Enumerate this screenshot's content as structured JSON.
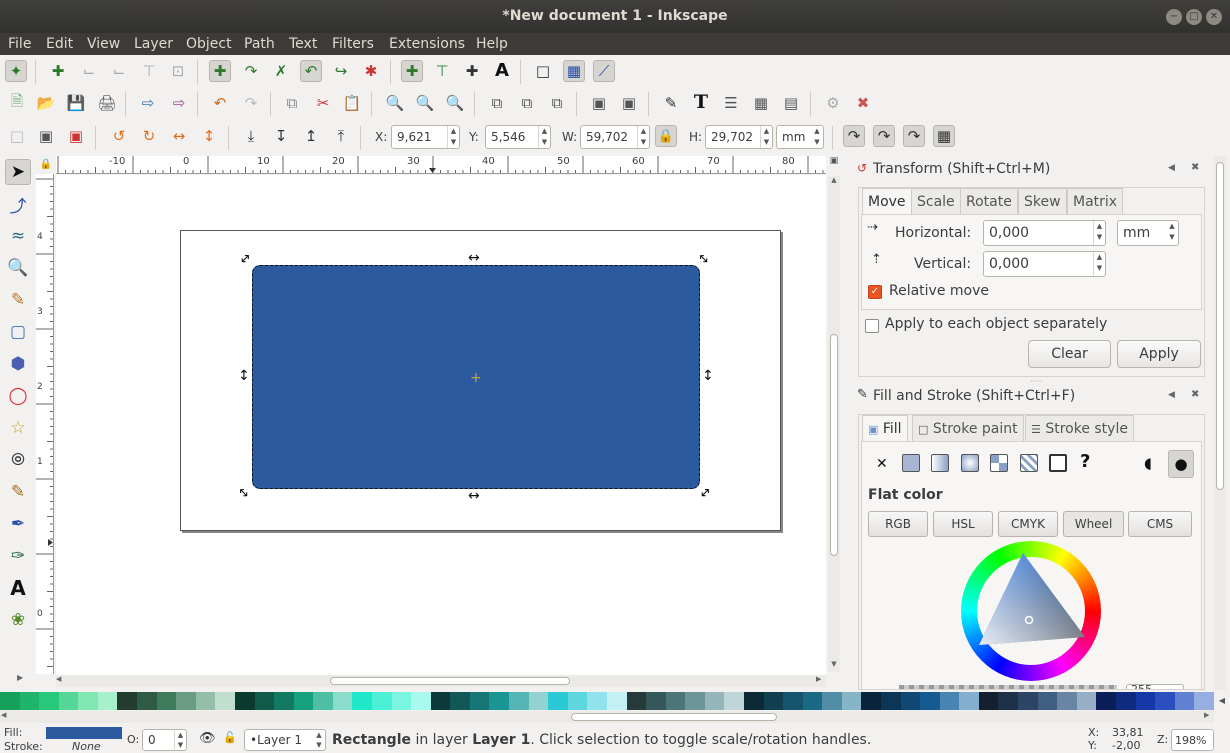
{
  "window": {
    "title": "*New document 1 - Inkscape",
    "buttons": [
      "−",
      "□",
      "✕"
    ]
  },
  "menubar": [
    "File",
    "Edit",
    "View",
    "Layer",
    "Object",
    "Path",
    "Text",
    "Filters",
    "Extensions",
    "Help"
  ],
  "toolbar": {
    "x_label": "X:",
    "x_value": "9,621",
    "y_label": "Y:",
    "y_value": "5,546",
    "w_label": "W:",
    "w_value": "59,702",
    "h_label": "H:",
    "h_value": "29,702",
    "unit": "mm"
  },
  "rulers": {
    "h_labels": [
      "-10",
      "0",
      "10",
      "20",
      "30",
      "40",
      "50",
      "60",
      "70",
      "80"
    ],
    "v_labels": [
      "4",
      "3",
      "2",
      "1",
      "0"
    ]
  },
  "transform_panel": {
    "title": "Transform (Shift+Ctrl+M)",
    "tabs": [
      "Move",
      "Scale",
      "Rotate",
      "Skew",
      "Matrix"
    ],
    "horizontal_label": "Horizontal:",
    "horizontal_value": "0,000",
    "vertical_label": "Vertical:",
    "vertical_value": "0,000",
    "unit": "mm",
    "relative_move": "Relative move",
    "apply_each": "Apply to each object separately",
    "clear": "Clear",
    "apply": "Apply"
  },
  "fill_panel": {
    "title": "Fill and Stroke (Shift+Ctrl+F)",
    "tabs": [
      "Fill",
      "Stroke paint",
      "Stroke style"
    ],
    "flat_color": "Flat color",
    "modes": [
      "RGB",
      "HSL",
      "CMYK",
      "Wheel",
      "CMS"
    ],
    "alpha_partial": "255"
  },
  "statusbar": {
    "fill_label": "Fill:",
    "stroke_label": "Stroke:",
    "stroke_value": "None",
    "opacity_label": "O:",
    "opacity_value": "0",
    "layer": "•Layer 1",
    "msg_bold1": "Rectangle",
    "msg1": " in layer ",
    "msg_bold2": "Layer 1",
    "msg2": ". Click selection to toggle scale/rotation handles.",
    "x_label": "X:",
    "x_value": "33,81",
    "y_label": "Y:",
    "y_value": "-2,00",
    "zoom_label": "Z:",
    "zoom_value": "198%"
  },
  "colors": {
    "rect_fill": "#2b5a9e",
    "accent": "#e95420"
  },
  "palette": [
    "#17a05a",
    "#1fb46a",
    "#27c87a",
    "#54d796",
    "#80e6b2",
    "#a8f0cc",
    "#243b30",
    "#2f5a45",
    "#3e7a5c",
    "#6a9c83",
    "#95bea9",
    "#c1dfd0",
    "#0b3a2f",
    "#0f5a48",
    "#137a62",
    "#17a07f",
    "#4fbfa4",
    "#8addca",
    "#1ee8c8",
    "#4cf0d6",
    "#7af5e2",
    "#a8faee",
    "#0c3a3a",
    "#115757",
    "#167575",
    "#1b9494",
    "#56b6b6",
    "#93d2d2",
    "#2ac9d6",
    "#5dd6e0",
    "#90e3ea",
    "#c3f0f4",
    "#263a3c",
    "#35575a",
    "#4b7579",
    "#6d9599",
    "#95b6b9",
    "#bfd6d8",
    "#0c2a35",
    "#103f50",
    "#15546b",
    "#1a6a86",
    "#4f8ea6",
    "#86b5c7",
    "#08233a",
    "#0c3557",
    "#104774",
    "#155a91",
    "#4a84b2",
    "#82aed0",
    "#142030",
    "#1f3148",
    "#2d4564",
    "#405d82",
    "#6a84a4",
    "#98adc6",
    "#0a1e5a",
    "#0f2b80",
    "#1638a6",
    "#2c4fc0",
    "#6180d2",
    "#97aee2"
  ]
}
